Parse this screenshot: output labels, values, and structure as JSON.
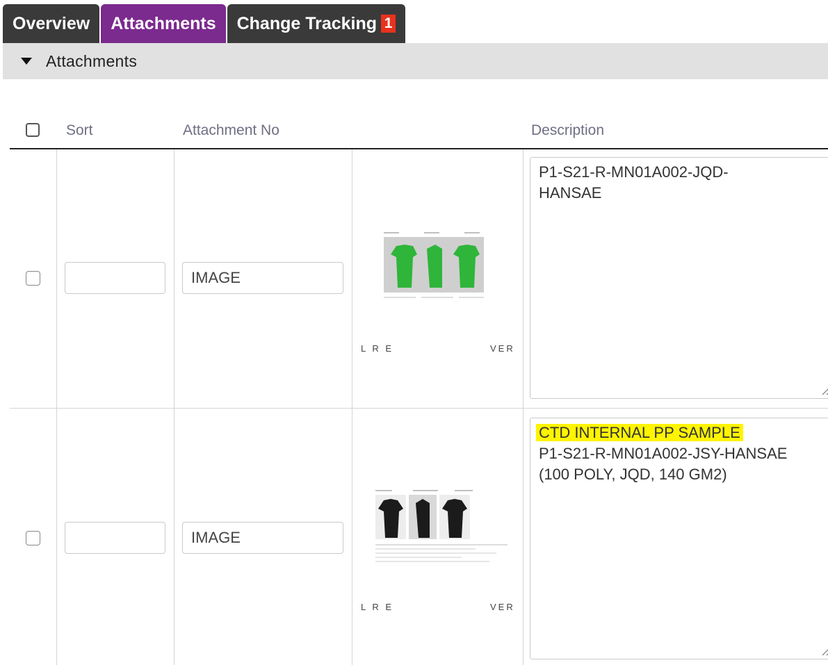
{
  "tabs": [
    {
      "label": "Overview",
      "active": false
    },
    {
      "label": "Attachments",
      "active": true
    },
    {
      "label": "Change Tracking",
      "active": false,
      "badge": "1"
    }
  ],
  "section": {
    "title": "Attachments"
  },
  "table": {
    "headers": {
      "sort": "Sort",
      "attachment_no": "Attachment No",
      "description": "Description"
    },
    "rows": [
      {
        "sort": "",
        "attachment_no": "IMAGE",
        "thumbnail": {
          "garment_color": "#2fb53a",
          "caption_left": "L R E",
          "caption_right": "VER"
        },
        "description": {
          "highlight": "",
          "lines": [
            "P1-S21-R-MN01A002-JQD-",
            "HANSAE"
          ]
        }
      },
      {
        "sort": "",
        "attachment_no": "IMAGE",
        "thumbnail": {
          "garment_color": "#1b1b1b",
          "caption_left": "L R E",
          "caption_right": "VER"
        },
        "description": {
          "highlight": "CTD INTERNAL PP SAMPLE",
          "lines": [
            "P1-S21-R-MN01A002-JSY-HANSAE",
            "(100 POLY, JQD, 140 GM2)"
          ]
        }
      }
    ]
  },
  "colors": {
    "active_tab": "#7b2a8e",
    "tab": "#3a3a3a",
    "badge": "#e8321e",
    "highlight": "#fff400"
  }
}
